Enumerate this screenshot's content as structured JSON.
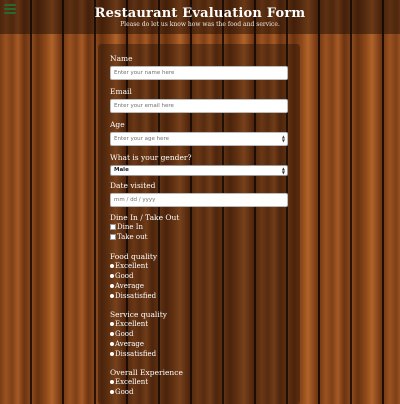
{
  "header": {
    "title": "Restaurant Evaluation Form",
    "subtitle": "Please do let us know how was the food and service."
  },
  "menu": {
    "icon": "hamburger-menu-icon"
  },
  "form": {
    "name": {
      "label": "Name",
      "placeholder": "Enter your name here"
    },
    "email": {
      "label": "Email",
      "placeholder": "Enter your email here"
    },
    "age": {
      "label": "Age",
      "placeholder": "Enter your age here"
    },
    "gender": {
      "label": "What is your gender?",
      "selected": "Male"
    },
    "date": {
      "label": "Date visited",
      "placeholder": "mm / dd / yyyy"
    },
    "dine": {
      "label": "Dine In / Take Out",
      "options": [
        "Dine In",
        "Take out"
      ]
    },
    "food_quality": {
      "label": "Food quality",
      "options": [
        "Excellent",
        "Good",
        "Average",
        "Dissatisfied"
      ]
    },
    "service_quality": {
      "label": "Service quality",
      "options": [
        "Excellent",
        "Good",
        "Average",
        "Dissatisfied"
      ]
    },
    "overall": {
      "label": "Overall Experience",
      "options": [
        "Excellent",
        "Good"
      ]
    }
  },
  "colors": {
    "menu_icon": "#3fb34f",
    "header_bg": "rgba(20,8,2,0.45)",
    "wood": "#7a3d16"
  }
}
